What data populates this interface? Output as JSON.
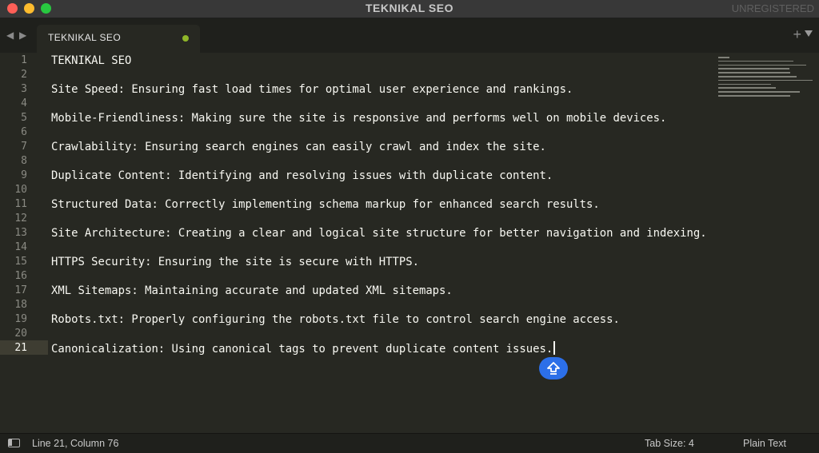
{
  "window": {
    "title": "TEKNIKAL SEO",
    "registration": "UNREGISTERED"
  },
  "tabs": [
    {
      "label": "TEKNIKAL SEO",
      "modified": true
    }
  ],
  "editor": {
    "line_numbers": [
      "1",
      "2",
      "3",
      "4",
      "5",
      "6",
      "7",
      "8",
      "9",
      "10",
      "11",
      "12",
      "13",
      "14",
      "15",
      "16",
      "17",
      "18",
      "19",
      "20",
      "21"
    ],
    "active_line": 21,
    "lines": [
      "TEKNIKAL SEO",
      "",
      "Site Speed: Ensuring fast load times for optimal user experience and rankings.",
      "",
      "Mobile-Friendliness: Making sure the site is responsive and performs well on mobile devices.",
      "",
      "Crawlability: Ensuring search engines can easily crawl and index the site.",
      "",
      "Duplicate Content: Identifying and resolving issues with duplicate content.",
      "",
      "Structured Data: Correctly implementing schema markup for enhanced search results.",
      "",
      "Site Architecture: Creating a clear and logical site structure for better navigation and indexing.",
      "",
      "HTTPS Security: Ensuring the site is secure with HTTPS.",
      "",
      "XML Sitemaps: Maintaining accurate and updated XML sitemaps.",
      "",
      "Robots.txt: Properly configuring the robots.txt file to control search engine access.",
      "",
      "Canonicalization: Using canonical tags to prevent duplicate content issues."
    ]
  },
  "statusbar": {
    "position": "Line 21, Column 76",
    "tab_size": "Tab Size: 4",
    "syntax": "Plain Text"
  },
  "colors": {
    "background": "#272822",
    "text": "#f8f8f2",
    "accent": "#2c6fe8",
    "modified_dot": "#8fb629"
  },
  "icons": [
    "back-arrow-icon",
    "forward-arrow-icon",
    "plus-icon",
    "dropdown-arrow-icon",
    "sidebar-toggle-icon",
    "upload-arrow-icon"
  ]
}
